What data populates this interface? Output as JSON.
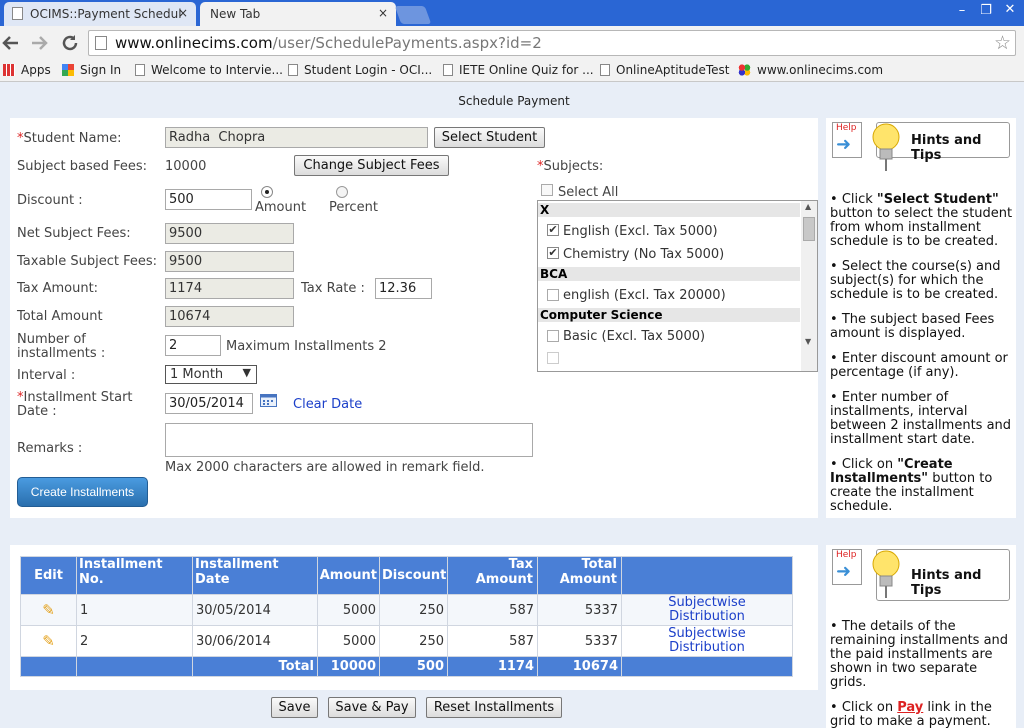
{
  "browser": {
    "tabs": [
      {
        "title": "OCIMS::Payment Schedul",
        "close": "×"
      },
      {
        "title": "New Tab",
        "close": "×"
      }
    ],
    "window_controls": [
      "–",
      "❐",
      "✕"
    ],
    "url": {
      "host": "www.onlinecims.com",
      "path": "/user/SchedulePayments.aspx?id=2"
    },
    "bookmarks": [
      "Apps",
      "Sign In",
      "Welcome to Intervie...",
      "Student Login - OCI...",
      "IETE Online Quiz for ...",
      "OnlineAptitudeTest",
      "www.onlinecims.com"
    ]
  },
  "page": {
    "title": "Schedule Payment"
  },
  "form": {
    "student_name_label": "Student Name:",
    "student_name_value": "Radha  Chopra",
    "select_student_button": "Select Student",
    "subject_fees_label": "Subject based Fees:",
    "subject_fees_value": "10000",
    "change_fees_button": "Change Subject Fees",
    "discount_label": "Discount :",
    "discount_value": "500",
    "radio_amount": "Amount",
    "radio_percent": "Percent",
    "net_fees_label": "Net Subject Fees:",
    "net_fees_value": "9500",
    "taxable_label": "Taxable Subject Fees:",
    "taxable_value": "9500",
    "tax_amount_label": "Tax Amount:",
    "tax_amount_value": "1174",
    "tax_rate_label": "Tax Rate :",
    "tax_rate_value": "12.36",
    "total_label": "Total Amount",
    "total_value": "10674",
    "num_inst_label_1": "Number of",
    "num_inst_label_2": "installments :",
    "num_inst_value": "2",
    "max_inst_text": "Maximum Installments 2",
    "interval_label": "Interval :",
    "interval_value": "1 Month",
    "start_date_label_1": "Installment Start",
    "start_date_label_2": "Date :",
    "start_date_value": "30/05/2014",
    "clear_date_link": "Clear Date",
    "remarks_label": "Remarks :",
    "remarks_note": "Max 2000 characters are allowed in remark field.",
    "create_button": "Create Installments",
    "subjects_label": "Subjects:",
    "select_all": "Select All"
  },
  "subjects": [
    {
      "group": "X",
      "items": [
        {
          "label": "English (Excl. Tax 5000)",
          "checked": true
        },
        {
          "label": "Chemistry (No Tax 5000)",
          "checked": true
        }
      ]
    },
    {
      "group": "BCA",
      "items": [
        {
          "label": "english (Excl. Tax 20000)",
          "checked": false
        }
      ]
    },
    {
      "group": "Computer Science",
      "items": [
        {
          "label": "Basic (Excl. Tax 5000)",
          "checked": false
        }
      ]
    }
  ],
  "hints1": {
    "help_label": "Help",
    "title": "Hints and Tips",
    "items": [
      [
        "Click ",
        "\"Select Student\"",
        " button to select the student from whom installment schedule is to be created."
      ],
      [
        "Select the course(s) and subject(s) for which the schedule is to be created.",
        "",
        ""
      ],
      [
        "The subject based Fees amount is displayed.",
        "",
        ""
      ],
      [
        "Enter discount amount or percentage (if any).",
        "",
        ""
      ],
      [
        "Enter number of installments, interval between 2 installments and installment start date.",
        "",
        ""
      ],
      [
        "Click on ",
        "\"Create Installments\"",
        " button to create the installment schedule."
      ]
    ]
  },
  "hints2": {
    "help_label": "Help",
    "title": "Hints and Tips",
    "item1": "The details of the remaining installments and the paid installments are shown in two separate grids.",
    "item2_pre": "Click on ",
    "item2_link": "Pay",
    "item2_post": " link in the grid to make a payment."
  },
  "table": {
    "headers": {
      "edit": "Edit",
      "no_1": "Installment",
      "no_2": "No.",
      "date_1": "Installment",
      "date_2": "Date",
      "amount": "Amount",
      "discount": "Discount",
      "tax_1": "Tax",
      "tax_2": "Amount",
      "total_1": "Total",
      "total_2": "Amount"
    },
    "rows": [
      {
        "no": "1",
        "date": "30/05/2014",
        "amount": "5000",
        "discount": "250",
        "tax": "587",
        "total": "5337",
        "link_1": "Subjectwise",
        "link_2": "Distribution"
      },
      {
        "no": "2",
        "date": "30/06/2014",
        "amount": "5000",
        "discount": "250",
        "tax": "587",
        "total": "5337",
        "link_1": "Subjectwise",
        "link_2": "Distribution"
      }
    ],
    "footer": {
      "label": "Total",
      "amount": "10000",
      "discount": "500",
      "tax": "1174",
      "total": "10674"
    }
  },
  "actions": {
    "save": "Save",
    "save_pay": "Save & Pay",
    "reset": "Reset Installments"
  },
  "colors": {
    "chrome_blue": "#2a66d4",
    "grid_header": "#4a7fd6",
    "button_blue": "#2f7fc4",
    "required": "#dd2222"
  }
}
